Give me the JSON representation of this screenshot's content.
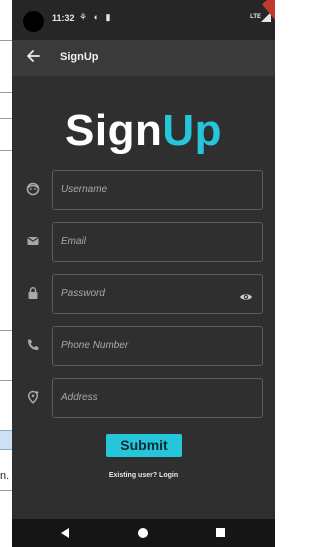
{
  "background_document": {
    "truncated_text": "n."
  },
  "status_bar": {
    "time": "11:32",
    "notification_icons": "⚘ ◐ ▮",
    "network": "LTE"
  },
  "app_bar": {
    "back_icon": "arrow-left-icon",
    "title": "SignUp"
  },
  "hero_title": {
    "part1": "Sign",
    "part2": "Up",
    "part1_color": "#ffffff",
    "part2_color": "#26c6da"
  },
  "form": {
    "fields": [
      {
        "icon": "face-icon",
        "placeholder": "Username"
      },
      {
        "icon": "email-icon",
        "placeholder": "Email"
      },
      {
        "icon": "lock-icon",
        "placeholder": "Password",
        "trailing_icon": "eye-icon"
      },
      {
        "icon": "phone-icon",
        "placeholder": "Phone Number"
      },
      {
        "icon": "location-icon",
        "placeholder": "Address"
      }
    ],
    "submit_label": "Submit",
    "login_link": "Existing user? Login"
  },
  "nav_bar": {
    "back": "nav-back-icon",
    "home": "nav-home-icon",
    "recents": "nav-recents-icon"
  },
  "colors": {
    "background": "#2f2f2f",
    "app_bar": "#3a3a3a",
    "accent": "#26c6da",
    "field_border": "#5c5c5c"
  }
}
